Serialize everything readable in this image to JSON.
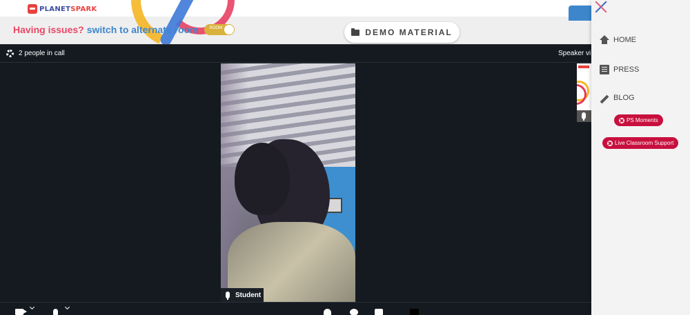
{
  "header": {
    "logo_text_1": "PLANET",
    "logo_text_2": "SPARK",
    "issues_question": "Having issues?",
    "issues_link": "switch to alternate room",
    "toggle_label": "ROOM",
    "demo_button": "DEMO MATERIAL"
  },
  "call": {
    "people_count": "2 people in call",
    "view_mode": "Speaker vi",
    "participant_name": "Student"
  },
  "drawer": {
    "items": [
      {
        "label": "HOME",
        "icon": "home-icon"
      },
      {
        "label": "PRESS",
        "icon": "newspaper-icon"
      },
      {
        "label": "BLOG",
        "icon": "pencil-icon"
      }
    ],
    "pills": [
      "PS Moments",
      "Live Classroom Support"
    ]
  },
  "colors": {
    "brand_red": "#e8423f",
    "brand_blue": "#3d86cc",
    "pill_red": "#c8103e",
    "call_bg": "#151a20",
    "toggle_yellow": "#d9b13c"
  }
}
